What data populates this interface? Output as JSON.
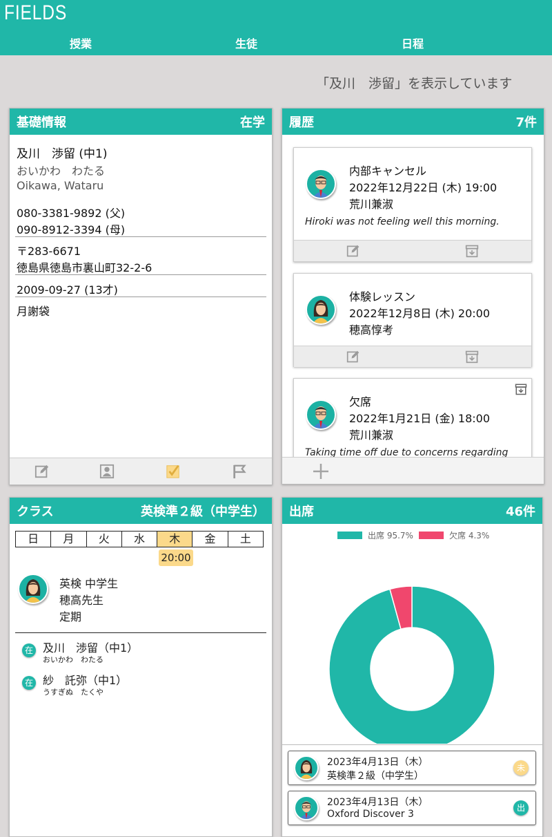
{
  "app": {
    "brand": "FIELDS"
  },
  "nav": {
    "items": [
      "授業",
      "生徒",
      "日程"
    ]
  },
  "notice": "「及川　渉留」を表示しています",
  "basic": {
    "title": "基礎情報",
    "status": "在学",
    "name": "及川　渉留 (中1)",
    "kana": "おいかわ　わたる",
    "romaji": "Oikawa, Wataru",
    "phone1": "080-3381-9892 (父)",
    "phone2": "090-8912-3394 (母)",
    "postal": "〒283-6671",
    "address": "徳島県徳島市裏山町32-2-6",
    "birth": "2009-09-27 (13才)",
    "payment": "月謝袋"
  },
  "history": {
    "title": "履歴",
    "count": "7件",
    "items": [
      {
        "type": "内部キャンセル",
        "datetime": "2022年12月22日 (木) 19:00",
        "staff": "荒川兼淑",
        "note": "Hiroki was not feeling well this morning."
      },
      {
        "type": "体験レッスン",
        "datetime": "2022年12月8日 (木) 20:00",
        "staff": "穂高惇考",
        "note": ""
      },
      {
        "type": "欠席",
        "datetime": "2022年1月21日 (金) 18:00",
        "staff": "荒川兼淑",
        "note": "Taking time off due to concerns regarding"
      }
    ]
  },
  "classcard": {
    "title": "クラス",
    "course": "英検準２級（中学生）",
    "days": [
      "日",
      "月",
      "火",
      "水",
      "木",
      "金",
      "土"
    ],
    "time": "20:00",
    "teacher_lines": [
      "英検 中学生",
      "穂高先生",
      "定期"
    ],
    "students": [
      {
        "badge": "在",
        "name": "及川　渉留（中1）",
        "kana": "おいかわ　わたる"
      },
      {
        "badge": "在",
        "name": "紗　託弥（中1）",
        "kana": "うすぎぬ　たくや"
      }
    ]
  },
  "attendance": {
    "title": "出席",
    "count": "46件",
    "colors": {
      "present": "#20b7a8",
      "absent": "#f0476d"
    },
    "records": [
      {
        "date": "2023年4月13日（木）",
        "course": "英検準２級（中学生）",
        "badge": "未",
        "badge_color": "#fbd98a"
      },
      {
        "date": "2023年4月13日（木）",
        "course": "Oxford Discover 3",
        "badge": "出",
        "badge_color": "#20b7a8"
      }
    ]
  },
  "chart_data": {
    "type": "pie",
    "categories": [
      "出席",
      "欠席"
    ],
    "values": [
      95.7,
      4.3
    ],
    "legend_labels": [
      "出席 95.7%",
      "欠席 4.3%"
    ],
    "colors": [
      "#20b7a8",
      "#f0476d"
    ],
    "legend": "top"
  }
}
